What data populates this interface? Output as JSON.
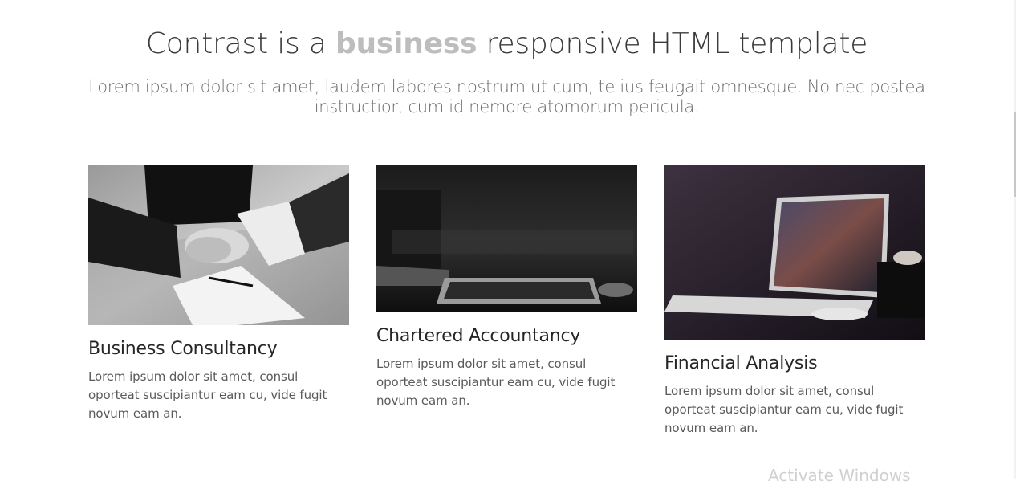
{
  "hero": {
    "title_part1": "Contrast is a ",
    "title_highlight": "business",
    "title_part2": " responsive HTML template",
    "subtitle": "Lorem ipsum dolor sit amet, laudem labores nostrum ut cum, te ius feugait omnesque. No nec postea instructior, cum id nemore atomorum pericula."
  },
  "services": [
    {
      "title": "Business Consultancy",
      "text": "Lorem ipsum dolor sit amet, consul oporteat suscipiantur eam cu, vide fugit novum eam an.",
      "image": "handshake-photo"
    },
    {
      "title": "Chartered Accountancy",
      "text": "Lorem ipsum dolor sit amet, consul oporteat suscipiantur eam cu, vide fugit novum eam an.",
      "image": "keyboard-desk-photo"
    },
    {
      "title": "Financial Analysis",
      "text": "Lorem ipsum dolor sit amet, consul oporteat suscipiantur eam cu, vide fugit novum eam an.",
      "image": "laptop-desk-photo"
    }
  ],
  "watermark": "Activate Windows",
  "colors": {
    "highlight": "#bdbdbd",
    "heading": "#3b3b3b",
    "body_text": "#5a5a5a"
  }
}
